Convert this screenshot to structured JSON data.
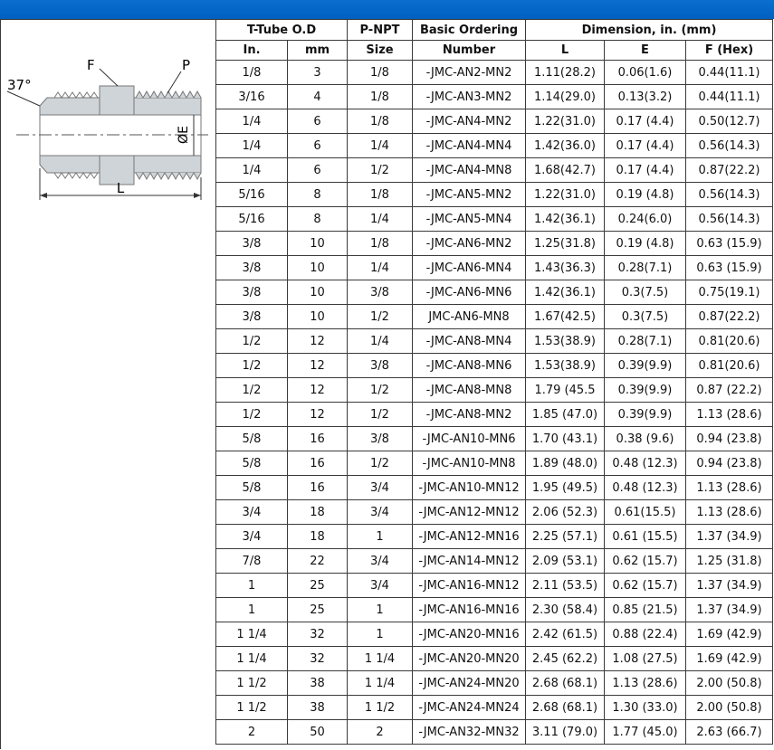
{
  "drawing": {
    "angle": "37°",
    "label_f": "F",
    "label_p": "P",
    "label_e": "ØE",
    "label_l": "L"
  },
  "headers": {
    "group_tube": "T-Tube O.D",
    "group_npt": "P-NPT",
    "group_number": "Basic Ordering",
    "group_dim": "Dimension, in. (mm)",
    "sub_in": "In.",
    "sub_mm": "mm",
    "sub_size": "Size",
    "sub_number": "Number",
    "sub_l": "L",
    "sub_e": "E",
    "sub_f": "F (Hex)"
  },
  "rows": [
    [
      "1/8",
      "3",
      "1/8",
      "-JMC-AN2-MN2",
      "1.11(28.2)",
      "0.06(1.6)",
      "0.44(11.1)"
    ],
    [
      "3/16",
      "4",
      "1/8",
      "-JMC-AN3-MN2",
      "1.14(29.0)",
      "0.13(3.2)",
      "0.44(11.1)"
    ],
    [
      "1/4",
      "6",
      "1/8",
      "-JMC-AN4-MN2",
      "1.22(31.0)",
      "0.17 (4.4)",
      "0.50(12.7)"
    ],
    [
      "1/4",
      "6",
      "1/4",
      "-JMC-AN4-MN4",
      "1.42(36.0)",
      "0.17 (4.4)",
      "0.56(14.3)"
    ],
    [
      "1/4",
      "6",
      "1/2",
      "-JMC-AN4-MN8",
      "1.68(42.7)",
      "0.17 (4.4)",
      "0.87(22.2)"
    ],
    [
      "5/16",
      "8",
      "1/8",
      "-JMC-AN5-MN2",
      "1.22(31.0)",
      "0.19 (4.8)",
      "0.56(14.3)"
    ],
    [
      "5/16",
      "8",
      "1/4",
      "-JMC-AN5-MN4",
      "1.42(36.1)",
      "0.24(6.0)",
      "0.56(14.3)"
    ],
    [
      "3/8",
      "10",
      "1/8",
      "-JMC-AN6-MN2",
      "1.25(31.8)",
      "0.19 (4.8)",
      "0.63 (15.9)"
    ],
    [
      "3/8",
      "10",
      "1/4",
      "-JMC-AN6-MN4",
      "1.43(36.3)",
      "0.28(7.1)",
      "0.63 (15.9)"
    ],
    [
      "3/8",
      "10",
      "3/8",
      "-JMC-AN6-MN6",
      "1.42(36.1)",
      "0.3(7.5)",
      "0.75(19.1)"
    ],
    [
      "3/8",
      "10",
      "1/2",
      "JMC-AN6-MN8",
      "1.67(42.5)",
      "0.3(7.5)",
      "0.87(22.2)"
    ],
    [
      "1/2",
      "12",
      "1/4",
      "-JMC-AN8-MN4",
      "1.53(38.9)",
      "0.28(7.1)",
      "0.81(20.6)"
    ],
    [
      "1/2",
      "12",
      "3/8",
      "-JMC-AN8-MN6",
      "1.53(38.9)",
      "0.39(9.9)",
      "0.81(20.6)"
    ],
    [
      "1/2",
      "12",
      "1/2",
      "-JMC-AN8-MN8",
      "1.79 (45.5",
      "0.39(9.9)",
      "0.87 (22.2)"
    ],
    [
      "1/2",
      "12",
      "1/2",
      "-JMC-AN8-MN2",
      "1.85 (47.0)",
      "0.39(9.9)",
      "1.13 (28.6)"
    ],
    [
      "5/8",
      "16",
      "3/8",
      "-JMC-AN10-MN6",
      "1.70 (43.1)",
      "0.38 (9.6)",
      "0.94 (23.8)"
    ],
    [
      "5/8",
      "16",
      "1/2",
      "-JMC-AN10-MN8",
      "1.89 (48.0)",
      "0.48 (12.3)",
      "0.94 (23.8)"
    ],
    [
      "5/8",
      "16",
      "3/4",
      "-JMC-AN10-MN12",
      "1.95 (49.5)",
      "0.48 (12.3)",
      "1.13 (28.6)"
    ],
    [
      "3/4",
      "18",
      "3/4",
      "-JMC-AN12-MN12",
      "2.06 (52.3)",
      "0.61(15.5)",
      "1.13 (28.6)"
    ],
    [
      "3/4",
      "18",
      "1",
      "-JMC-AN12-MN16",
      "2.25 (57.1)",
      "0.61 (15.5)",
      "1.37 (34.9)"
    ],
    [
      "7/8",
      "22",
      "3/4",
      "-JMC-AN14-MN12",
      "2.09 (53.1)",
      "0.62 (15.7)",
      "1.25 (31.8)"
    ],
    [
      "1",
      "25",
      "3/4",
      "-JMC-AN16-MN12",
      "2.11 (53.5)",
      "0.62 (15.7)",
      "1.37 (34.9)"
    ],
    [
      "1",
      "25",
      "1",
      "-JMC-AN16-MN16",
      "2.30 (58.4)",
      "0.85 (21.5)",
      "1.37 (34.9)"
    ],
    [
      "1 1/4",
      "32",
      "1",
      "-JMC-AN20-MN16",
      "2.42 (61.5)",
      "0.88 (22.4)",
      "1.69 (42.9)"
    ],
    [
      "1 1/4",
      "32",
      "1 1/4",
      "-JMC-AN20-MN20",
      "2.45 (62.2)",
      "1.08 (27.5)",
      "1.69 (42.9)"
    ],
    [
      "1 1/2",
      "38",
      "1 1/4",
      "-JMC-AN24-MN20",
      "2.68 (68.1)",
      "1.13 (28.6)",
      "2.00 (50.8)"
    ],
    [
      "1 1/2",
      "38",
      "1 1/2",
      "-JMC-AN24-MN24",
      "2.68 (68.1)",
      "1.30 (33.0)",
      "2.00 (50.8)"
    ],
    [
      "2",
      "50",
      "2",
      "-JMC-AN32-MN32",
      "3.11 (79.0)",
      "1.77 (45.0)",
      "2.63 (66.7)"
    ]
  ]
}
